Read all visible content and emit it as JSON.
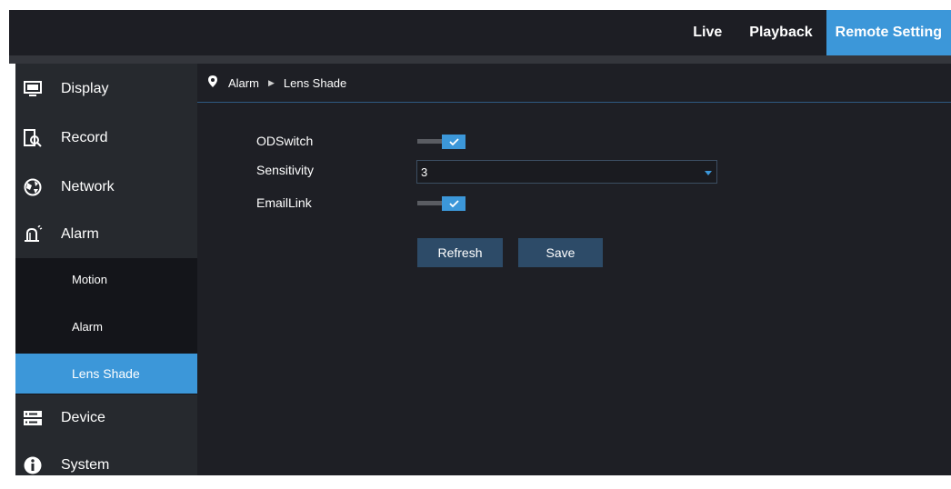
{
  "topnav": {
    "tabs": [
      {
        "label": "Live"
      },
      {
        "label": "Playback"
      },
      {
        "label": "Remote Setting"
      }
    ]
  },
  "sidebar": {
    "items": [
      {
        "label": "Display",
        "icon": "monitor-icon"
      },
      {
        "label": "Record",
        "icon": "record-search-icon"
      },
      {
        "label": "Network",
        "icon": "network-globe-icon"
      },
      {
        "label": "Alarm",
        "icon": "alarm-bell-icon"
      },
      {
        "label": "Device",
        "icon": "device-drives-icon"
      },
      {
        "label": "System",
        "icon": "info-icon"
      }
    ],
    "submenu": [
      {
        "label": "Motion"
      },
      {
        "label": "Alarm"
      },
      {
        "label": "Lens Shade"
      }
    ]
  },
  "breadcrumb": {
    "parent": "Alarm",
    "current": "Lens Shade"
  },
  "form": {
    "odswitch_label": "ODSwitch",
    "odswitch_checked": true,
    "sensitivity_label": "Sensitivity",
    "sensitivity_value": "3",
    "emaillink_label": "EmailLink",
    "emaillink_checked": true
  },
  "buttons": {
    "refresh": "Refresh",
    "save": "Save"
  },
  "colors": {
    "accent": "#3c97d9",
    "background": "#1e1f25",
    "sidebar": "#26292e"
  }
}
